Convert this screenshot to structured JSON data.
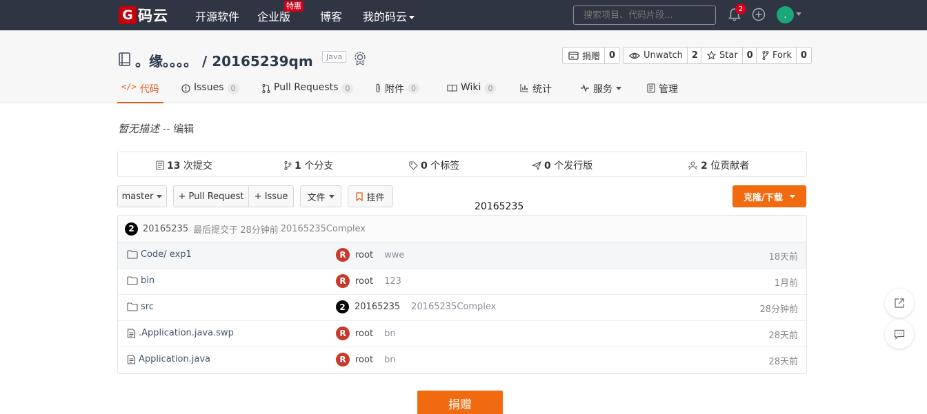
{
  "topnav": {
    "logo_letter": "G",
    "logo_text": "码云",
    "items": [
      "开源软件",
      "企业版",
      "博客",
      "我的码云"
    ],
    "enterprise_badge": "特惠",
    "search_placeholder": "搜索项目、代码片段...",
    "notification_count": "2",
    "avatar_initial": "."
  },
  "repo": {
    "title": "。缘。。。。 / 20165239qm",
    "language": "Java",
    "actions": [
      {
        "label": "捐赠",
        "count": "0"
      },
      {
        "label": "Unwatch",
        "count": "2"
      },
      {
        "label": "Star",
        "count": "0"
      },
      {
        "label": "Fork",
        "count": "0"
      }
    ]
  },
  "tabs": [
    {
      "label": "代码"
    },
    {
      "label": "Issues",
      "count": "0"
    },
    {
      "label": "Pull Requests",
      "count": "0"
    },
    {
      "label": "附件",
      "count": "0"
    },
    {
      "label": "Wiki",
      "count": "0"
    },
    {
      "label": "统计"
    },
    {
      "label": "服务"
    },
    {
      "label": "管理"
    }
  ],
  "description": {
    "text": "暂无描述",
    "sep": " -- ",
    "edit": "编辑"
  },
  "stats": [
    {
      "num": "13",
      "label": " 次提交"
    },
    {
      "num": "1",
      "label": " 个分支"
    },
    {
      "num": "0",
      "label": " 个标签"
    },
    {
      "num": "0",
      "label": " 个发行版"
    },
    {
      "num": "2",
      "label": " 位贡献者"
    }
  ],
  "toolbar": {
    "branch": "master",
    "pull_request": "+ Pull Request",
    "issue": "+ Issue",
    "files": "文件",
    "widget": "挂件",
    "clone": "克隆/下载"
  },
  "floating_label": "20165235",
  "last_commit": {
    "avatar": "2",
    "author": "20165235",
    "text": "最后提交于",
    "time": "28分钟前",
    "message": "20165235Complex"
  },
  "files": [
    {
      "type": "folder",
      "name": "Code/ exp1",
      "avatar": "R",
      "author": "root",
      "message": "wwe",
      "time": "18天前"
    },
    {
      "type": "folder",
      "name": "bin",
      "avatar": "R",
      "author": "root",
      "message": "123",
      "time": "1月前"
    },
    {
      "type": "folder",
      "name": "src",
      "avatar": "2",
      "author": "20165235",
      "message": "20165235Complex",
      "time": "28分钟前"
    },
    {
      "type": "file",
      "name": ".Application.java.swp",
      "avatar": "R",
      "author": "root",
      "message": "bn",
      "time": "28天前"
    },
    {
      "type": "file",
      "name": "Application.java",
      "avatar": "R",
      "author": "root",
      "message": "bn",
      "time": "28天前"
    }
  ],
  "donate_button": "捐赠",
  "colors": {
    "nav_bg": "#2f3542",
    "accent": "#f26a10",
    "active_tab": "#e55a1a",
    "avatar_red": "#c9392b",
    "brand_red": "#c7000b"
  }
}
